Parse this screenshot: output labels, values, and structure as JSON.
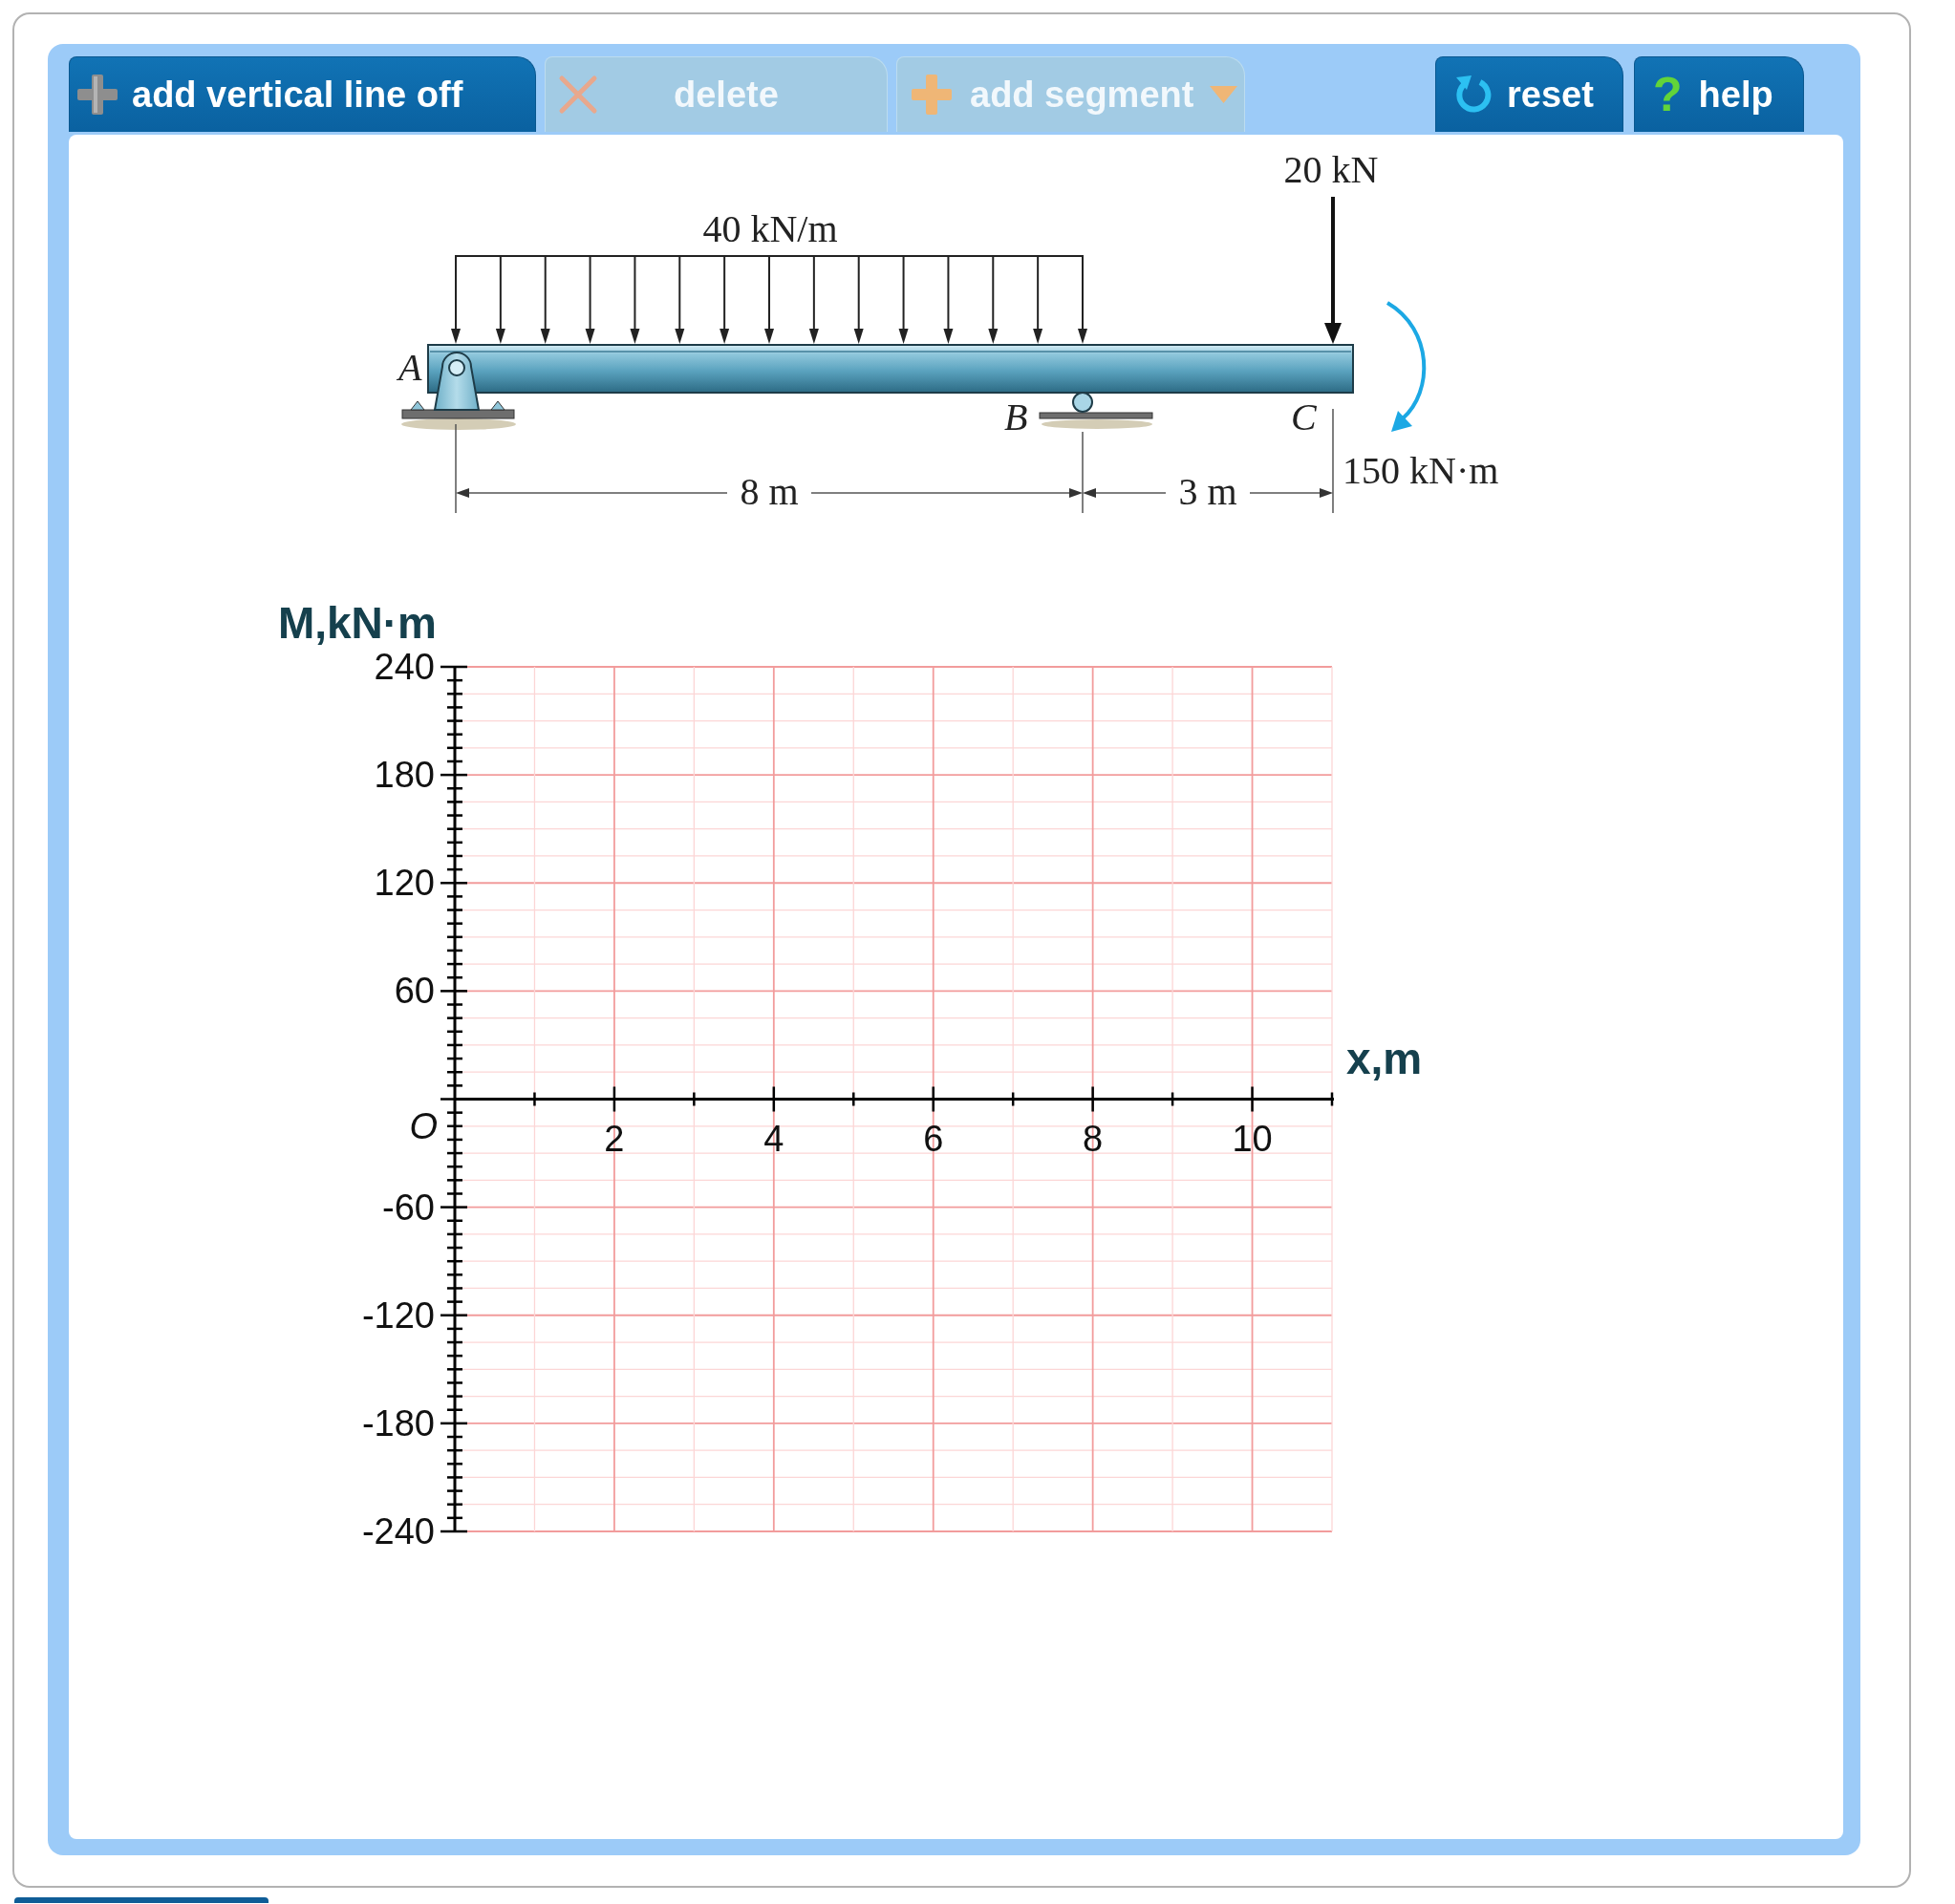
{
  "toolbar": {
    "left_buttons": [
      {
        "label": "add vertical line off",
        "kind": "add",
        "disabled": false
      },
      {
        "label": "delete",
        "kind": "delete",
        "disabled": true
      },
      {
        "label": "add segment",
        "kind": "dropdown",
        "disabled": true
      }
    ],
    "right_buttons": [
      {
        "label": "reset",
        "kind": "reset",
        "disabled": false
      },
      {
        "label": "help",
        "kind": "help",
        "icon": "?",
        "disabled": false
      }
    ]
  },
  "beam_figure": {
    "distributed_load": "40 kN/m",
    "point_load": "20 kN",
    "couple_moment": "150 kN·m",
    "points": [
      "A",
      "B",
      "C"
    ],
    "spans": [
      "8 m",
      "3 m"
    ]
  },
  "moment_diagram": {
    "origin_label": "O",
    "chart_data": {
      "type": "line",
      "xlabel": "x,m",
      "ylabel": "M,kN·m",
      "xlim": [
        0,
        11
      ],
      "ylim": [
        -240,
        240
      ],
      "xticks": [
        2,
        4,
        6,
        8,
        10
      ],
      "yticks": [
        -240,
        -180,
        -120,
        -60,
        60,
        120,
        180,
        240
      ],
      "grid": true
    }
  }
}
